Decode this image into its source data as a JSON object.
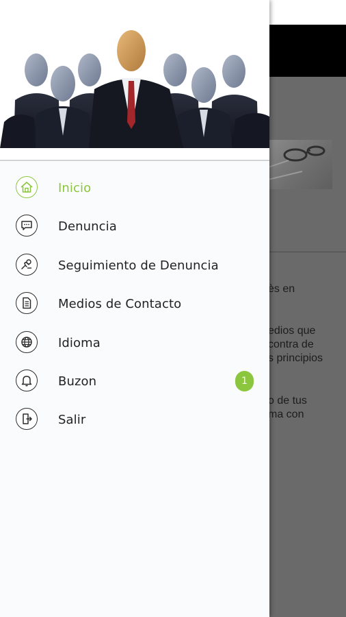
{
  "background": {
    "text_lines": [
      {
        "text": "ès en"
      },
      {
        "text": "edios que"
      },
      {
        "text": " contra de"
      },
      {
        "text": "s principios"
      },
      {
        "text": "o de tus"
      },
      {
        "text": "ma con"
      }
    ]
  },
  "drawer": {
    "header_image": "group-of-faceless-businessmen",
    "items": [
      {
        "id": "inicio",
        "label": "Inicio",
        "icon": "home-icon",
        "active": true
      },
      {
        "id": "denuncia",
        "label": "Denuncia",
        "icon": "chat-bubble-icon",
        "active": false
      },
      {
        "id": "seguimiento",
        "label": "Seguimiento de Denuncia",
        "icon": "hand-tracking-icon",
        "active": false
      },
      {
        "id": "medios",
        "label": "Medios de Contacto",
        "icon": "document-icon",
        "active": false
      },
      {
        "id": "idioma",
        "label": "Idioma",
        "icon": "globe-icon",
        "active": false
      },
      {
        "id": "buzon",
        "label": "Buzon",
        "icon": "bell-icon",
        "active": false,
        "badge": "1"
      },
      {
        "id": "salir",
        "label": "Salir",
        "icon": "exit-icon",
        "active": false
      }
    ]
  },
  "colors": {
    "accent": "#8cc63f",
    "text": "#222222",
    "overlay": "#6a6a6a"
  }
}
